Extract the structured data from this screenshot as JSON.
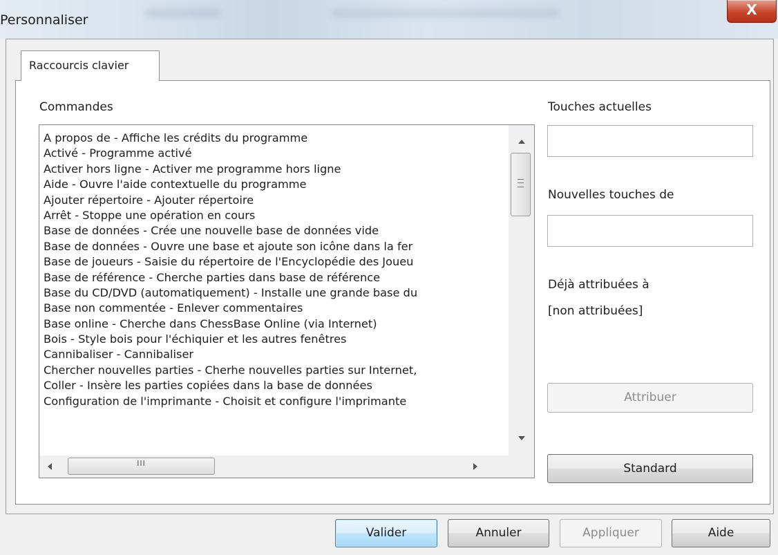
{
  "window": {
    "title": "Personnaliser",
    "close_glyph": "X"
  },
  "tabs": [
    {
      "label": "Raccourcis clavier",
      "active": true
    }
  ],
  "commands": {
    "label": "Commandes",
    "items": [
      "A propos de - Affiche les crédits du programme",
      "Activé - Programme activé",
      "Activer hors ligne - Activer me programme hors ligne",
      "Aide - Ouvre l'aide contextuelle du programme",
      "Ajouter répertoire - Ajouter répertoire",
      "Arrêt - Stoppe une opération en cours",
      "Base de données - Crée une nouvelle base de données vide",
      "Base de données - Ouvre une base et ajoute son icône dans la fer",
      "Base de joueurs - Saisie du répertoire de l'Encyclopédie des Joueu",
      "Base de référence - Cherche parties dans base de référence",
      "Base du CD/DVD (automatiquement) - Installe une grande base du",
      "Base non commentée - Enlever commentaires",
      "Base online - Cherche dans ChessBase Online (via Internet)",
      "Bois - Style bois pour l'échiquier et les autres fenêtres",
      "Cannibaliser - Cannibaliser",
      "Chercher nouvelles parties - Cherhe nouvelles parties sur Internet,",
      "Coller - Insère les parties copiées dans la base de données",
      "Configuration de l'imprimante - Choisit et configure l'imprimante"
    ],
    "hscroll_grip": "III"
  },
  "right_panel": {
    "current_keys_label": "Touches actuelles",
    "current_keys_value": "",
    "new_keys_label": "Nouvelles touches de",
    "new_keys_value": "",
    "assigned_to_label": "Déjà attribuées à",
    "assigned_to_value": "[non attribuées]",
    "assign_button": "Attribuer",
    "standard_button": "Standard"
  },
  "footer": {
    "ok_button": "Valider",
    "cancel_button": "Annuler",
    "apply_button": "Appliquer",
    "help_button": "Aide"
  },
  "colors": {
    "close_button": "#c7452a",
    "default_button_border": "#3c7fb1",
    "disabled_text": "#8d8d8d"
  }
}
